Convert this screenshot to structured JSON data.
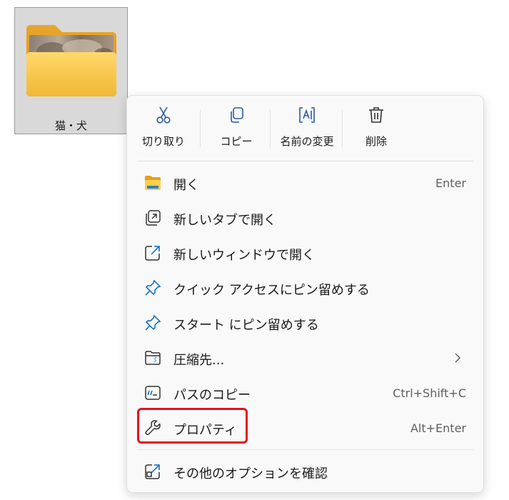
{
  "folder": {
    "name": "猫・犬",
    "icon": "folder-with-cat-photo-icon"
  },
  "toolbar": {
    "cut_label": "切り取り",
    "copy_label": "コピー",
    "rename_label": "名前の変更",
    "delete_label": "削除"
  },
  "menu": {
    "items": [
      {
        "label": "開く",
        "shortcut": "Enter",
        "icon": "folder-icon"
      },
      {
        "label": "新しいタブで開く",
        "shortcut": "",
        "icon": "new-tab-icon"
      },
      {
        "label": "新しいウィンドウで開く",
        "shortcut": "",
        "icon": "external-window-icon"
      },
      {
        "label": "クイック アクセスにピン留めする",
        "shortcut": "",
        "icon": "pin-icon"
      },
      {
        "label": "スタート にピン留めする",
        "shortcut": "",
        "icon": "pin-icon"
      },
      {
        "label": "圧縮先...",
        "shortcut": "",
        "icon": "zip-folder-icon"
      },
      {
        "label": "パスのコピー",
        "shortcut": "Ctrl+Shift+C",
        "icon": "copy-path-icon"
      },
      {
        "label": "プロパティ",
        "shortcut": "Alt+Enter",
        "icon": "wrench-icon"
      },
      {
        "label": "その他のオプションを確認",
        "shortcut": "",
        "icon": "more-options-icon"
      }
    ]
  },
  "colors": {
    "accent": "#0067c0",
    "highlight": "#e8101d",
    "folder_yellow": "#f5c34b"
  }
}
